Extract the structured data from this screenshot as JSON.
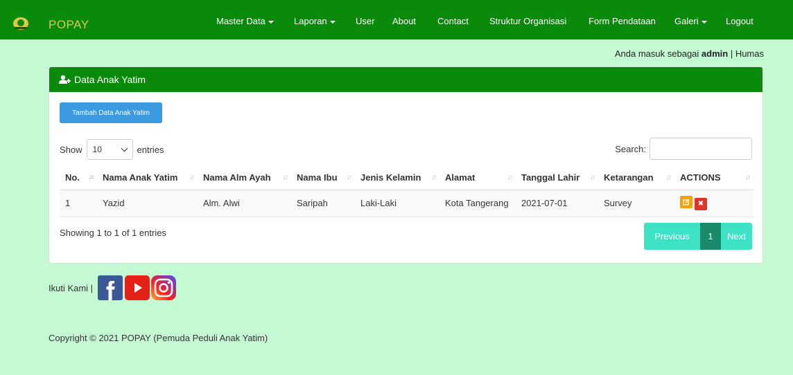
{
  "brand": "POPAY",
  "nav": {
    "master_data": "Master Data",
    "laporan": "Laporan",
    "user": "User",
    "about": "About",
    "contact": "Contact",
    "struktur": "Struktur Organisasi",
    "form": "Form Pendataan",
    "galeri": "Galeri",
    "logout": "Logout"
  },
  "userinfo": {
    "prefix": "Anda masuk sebagai ",
    "name": "admin",
    "sep": " | ",
    "role": "Humas"
  },
  "panel": {
    "title": "Data Anak Yatim",
    "add_button": "Tambah Data Anak Yatim"
  },
  "length": {
    "show": "Show",
    "value": "10",
    "entries": "entries"
  },
  "search": {
    "label": "Search:",
    "value": ""
  },
  "table": {
    "headers": [
      "No.",
      "Nama Anak Yatim",
      "Nama Alm Ayah",
      "Nama Ibu",
      "Jenis Kelamin",
      "Alamat",
      "Tanggal Lahir",
      "Ketarangan",
      "ACTIONS"
    ],
    "rows": [
      [
        "1",
        "Yazid",
        "Alm. Alwi",
        "Saripah",
        "Laki-Laki",
        "Kota Tangerang",
        "2021-07-01",
        "Survey"
      ]
    ]
  },
  "info": "Showing 1 to 1 of 1 entries",
  "pagination": {
    "previous": "Previous",
    "page": "1",
    "next": "Next"
  },
  "footer": {
    "follow": "Ikuti Kami |",
    "copyright": "Copyright © 2021 POPAY (Pemuda Peduli Anak Yatim)"
  },
  "colors": {
    "nav": "#0a8a0a",
    "body": "#c4f9d3",
    "add_button": "#3c9be0",
    "pager": "#3ee2c4",
    "pager_active": "#1b8a6a"
  }
}
